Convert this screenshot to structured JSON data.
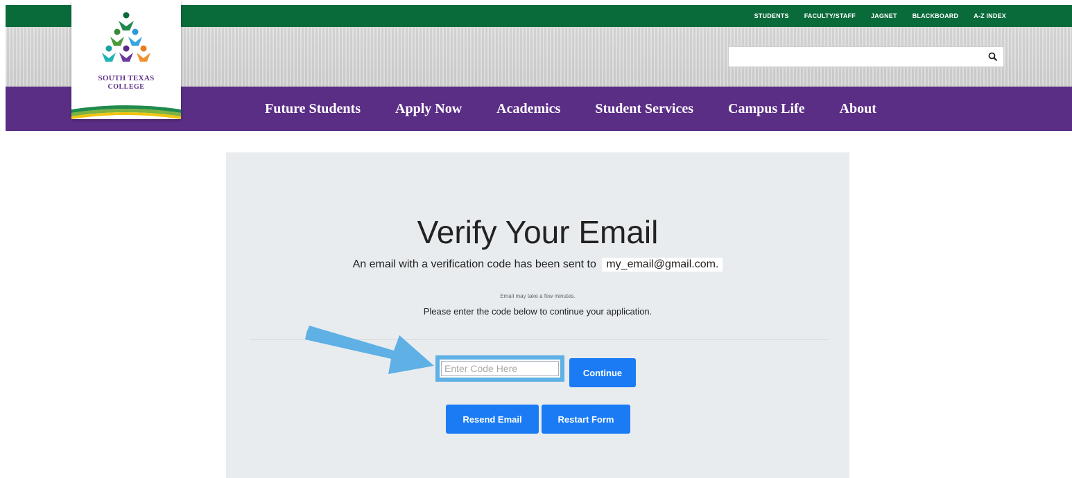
{
  "header": {
    "utility_links": [
      "STUDENTS",
      "FACULTY/STAFF",
      "JAGNET",
      "BLACKBOARD",
      "A-Z INDEX"
    ],
    "search": {
      "placeholder": "",
      "icon": "search-icon"
    },
    "logo": {
      "line1": "SOUTH TEXAS",
      "line2": "COLLEGE"
    },
    "nav": [
      "Future Students",
      "Apply Now",
      "Academics",
      "Student Services",
      "Campus Life",
      "About"
    ],
    "colors": {
      "green": "#0a6b3a",
      "purple": "#5b2e86"
    }
  },
  "main": {
    "title": "Verify Your Email",
    "sent_text": "An email with a verification code has been sent to",
    "email": "my_email@gmail.com.",
    "note": "Email may take a few minutes.",
    "instruction": "Please enter the code below to continue your application.",
    "code_input": {
      "placeholder": "Enter Code Here",
      "value": ""
    },
    "buttons": {
      "continue": "Continue",
      "resend": "Resend Email",
      "restart": "Restart Form"
    },
    "colors": {
      "button": "#1a7bf5",
      "highlight": "#5eb0e5"
    }
  },
  "annotation": {
    "arrow_icon": "arrow-icon"
  }
}
